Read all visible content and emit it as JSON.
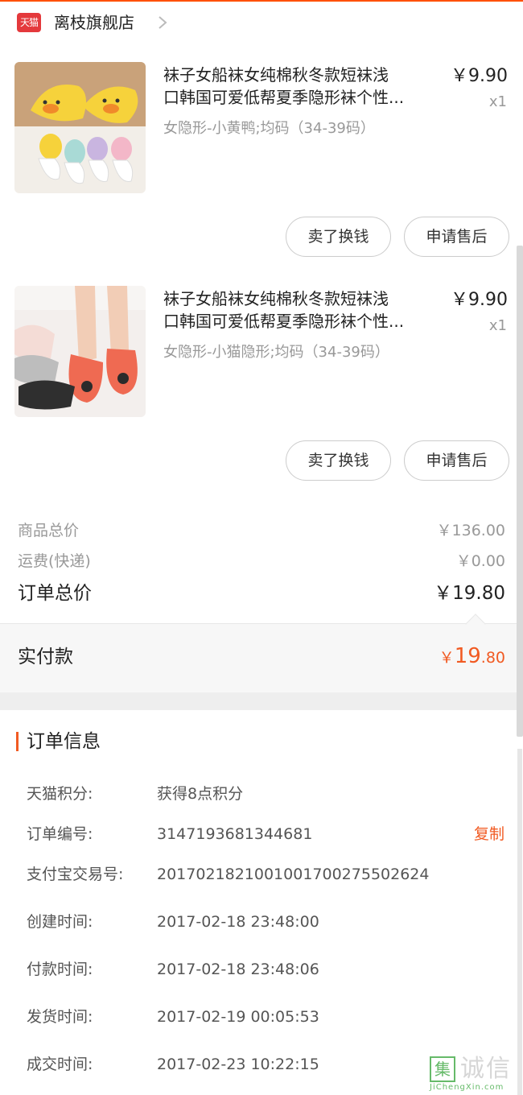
{
  "store": {
    "logo_text": "天猫",
    "name": "离枝旗舰店"
  },
  "products": [
    {
      "title_line1": "袜子女船袜女纯棉秋冬款短袜浅",
      "title_line2": "口韩国可爱低帮夏季隐形袜个性...",
      "sku": "女隐形-小黄鸭;均码（34-39码）",
      "price": "￥9.90",
      "qty": "x1",
      "image": "duck-socks-photo",
      "resell_label": "卖了换钱",
      "aftersale_label": "申请售后"
    },
    {
      "title_line1": "袜子女船袜女纯棉秋冬款短袜浅",
      "title_line2": "口韩国可爱低帮夏季隐形袜个性...",
      "sku": "女隐形-小猫隐形;均码（34-39码）",
      "price": "￥9.90",
      "qty": "x1",
      "image": "cat-socks-photo",
      "resell_label": "卖了换钱",
      "aftersale_label": "申请售后"
    }
  ],
  "summary": {
    "goods_total_label": "商品总价",
    "goods_total_value": "￥136.00",
    "shipping_label": "运费(快递)",
    "shipping_value": "￥0.00",
    "order_total_label": "订单总价",
    "order_total_value": "￥19.80",
    "paid_label": "实付款",
    "paid_currency": "￥",
    "paid_int": "19",
    "paid_dec": ".80"
  },
  "order_info": {
    "title": "订单信息",
    "copy_label": "复制",
    "rows": [
      {
        "label": "天猫积分:",
        "value": "获得8点积分"
      },
      {
        "label": "订单编号:",
        "value": "3147193681344681"
      },
      {
        "label": "支付宝交易号:",
        "value": "2017021821001001700275502624"
      },
      {
        "label": "创建时间:",
        "value": "2017-02-18 23:48:00"
      },
      {
        "label": "付款时间:",
        "value": "2017-02-18 23:48:06"
      },
      {
        "label": "发货时间:",
        "value": "2017-02-19 00:05:53"
      },
      {
        "label": "成交时间:",
        "value": "2017-02-23 10:22:15"
      }
    ]
  },
  "watermark": {
    "box_char": "集",
    "text": "诚信",
    "url": "JiChengXin.com"
  },
  "colors": {
    "accent": "#f15a22",
    "tmall_red": "#e4393c",
    "muted_text": "#999999"
  }
}
